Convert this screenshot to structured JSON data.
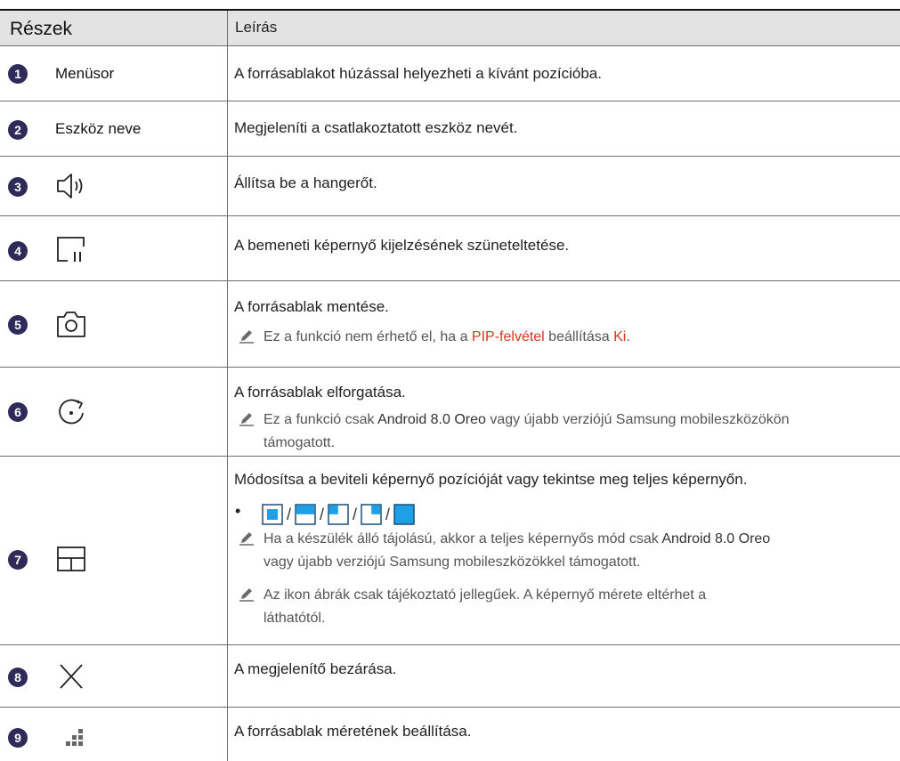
{
  "header": {
    "parts": "Részek",
    "description": "Leírás"
  },
  "rows": [
    {
      "num": "1",
      "part": "Menüsor",
      "desc": "A forrásablakot húzással helyezheti a kívánt pozícióba."
    },
    {
      "num": "2",
      "part": "Eszköz neve",
      "desc": "Megjeleníti a csatlakoztatott eszköz nevét."
    },
    {
      "num": "3",
      "icon": "speaker-icon",
      "desc": "Állítsa be a hangerőt."
    },
    {
      "num": "4",
      "icon": "pause-screen-icon",
      "desc": "A bemeneti képernyő kijelzésének szüneteltetése."
    },
    {
      "num": "5",
      "icon": "camera-icon",
      "desc": "A forrásablak mentése.",
      "note": {
        "pre": "Ez a funkció nem érhető el, ha a ",
        "hl1": "PIP-felvétel",
        "mid": " beállítása ",
        "hl2": "Ki",
        "post": "."
      }
    },
    {
      "num": "6",
      "icon": "rotate-icon",
      "desc": "A forrásablak elforgatása.",
      "note": {
        "pre": "Ez a funkció csak ",
        "b1": "Android 8.0 Oreo",
        "post1": " vagy újabb verziójú Samsung mobileszközökön",
        "line2": "támogatott."
      }
    },
    {
      "num": "7",
      "icon": "layout-icon",
      "desc": "Módosítsa a beviteli képernyő pozícióját vagy tekintse meg teljes képernyőn.",
      "bullet": "•",
      "note1": {
        "pre": "Ha a készülék álló tájolású, akkor a teljes képernyős mód csak ",
        "b1": "Android 8.0 Oreo",
        "line2": "vagy újabb verziójú Samsung mobileszközökkel támogatott."
      },
      "note2": {
        "line1": "Az ikon ábrák csak tájékoztató jellegűek. A képernyő mérete eltérhet a",
        "line2": "láthatótól."
      }
    },
    {
      "num": "8",
      "icon": "close-icon",
      "desc": "A megjelenítő bezárása."
    },
    {
      "num": "9",
      "icon": "resize-icon",
      "desc": "A forrásablak méretének beállítása."
    }
  ],
  "colors": {
    "badge": "#2e2a5a",
    "highlight": "#d4371b",
    "layout_fill": "#1ea0e6",
    "header_bg": "#e3e3e3"
  }
}
